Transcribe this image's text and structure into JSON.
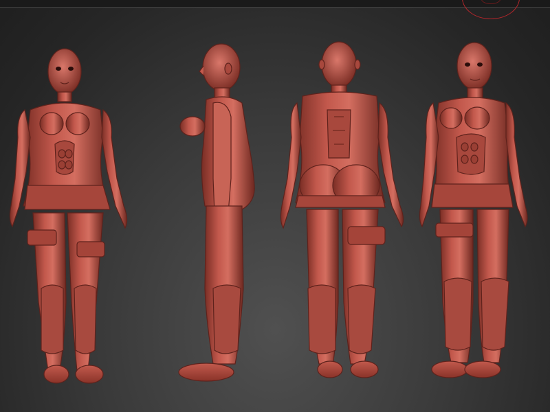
{
  "viewport": {
    "background_color": "#3a3a3a",
    "material_color": "#b3534a",
    "material_dark": "#5e221c",
    "material_light": "#d9786a",
    "nav_ring_color": "#b3262b"
  },
  "views": [
    {
      "name": "front",
      "icon": "figure-front-icon"
    },
    {
      "name": "side",
      "icon": "figure-side-icon"
    },
    {
      "name": "back",
      "icon": "figure-back-icon"
    },
    {
      "name": "three-quarter",
      "icon": "figure-three-quarter-icon"
    }
  ]
}
